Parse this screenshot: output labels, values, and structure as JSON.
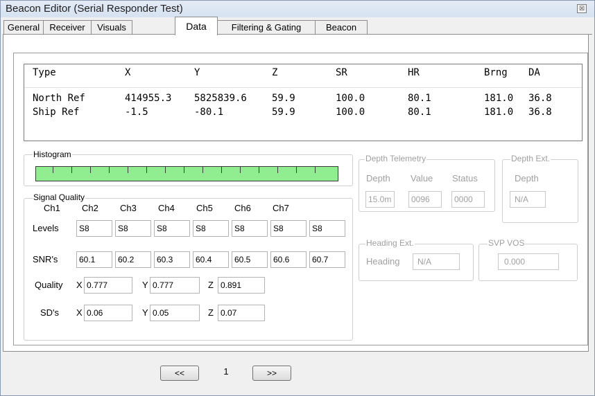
{
  "window": {
    "title": "Beacon Editor (Serial Responder Test)",
    "close_glyph": "☒"
  },
  "tabs": [
    "General",
    "Receiver",
    "Visuals",
    "Data",
    "Filtering & Gating",
    "Beacon"
  ],
  "active_tab": "Data",
  "grid": {
    "columns": [
      "Type",
      "X",
      "Y",
      "Z",
      "SR",
      "HR",
      "Brng",
      "DA"
    ],
    "rows": [
      [
        "North Ref",
        "414955.3",
        "5825839.6",
        "59.9",
        "100.0",
        "80.1",
        "181.0",
        "36.8"
      ],
      [
        "Ship Ref",
        "-1.5",
        "-80.1",
        "59.9",
        "100.0",
        "80.1",
        "181.0",
        "36.8"
      ]
    ]
  },
  "histogram": {
    "title": "Histogram",
    "bar_color": "#90ee90"
  },
  "signal_quality": {
    "title": "Signal Quality",
    "channels": [
      "Ch1",
      "Ch2",
      "Ch3",
      "Ch4",
      "Ch5",
      "Ch6",
      "Ch7"
    ],
    "levels_label": "Levels",
    "levels": [
      "S8",
      "S8",
      "S8",
      "S8",
      "S8",
      "S8",
      "S8"
    ],
    "snr_label": "SNR's",
    "snrs": [
      "60.1",
      "60.2",
      "60.3",
      "60.4",
      "60.5",
      "60.6",
      "60.7"
    ],
    "quality_label": "Quality",
    "quality": {
      "x_label": "X",
      "x": "0.777",
      "y_label": "Y",
      "y": "0.777",
      "z_label": "Z",
      "z": "0.891"
    },
    "sd_label": "SD's",
    "sd": {
      "x_label": "X",
      "x": "0.06",
      "y_label": "Y",
      "y": "0.05",
      "z_label": "Z",
      "z": "0.07"
    }
  },
  "depth_telemetry": {
    "title": "Depth Telemetry",
    "depth_label": "Depth",
    "value_label": "Value",
    "status_label": "Status",
    "depth": "15.0m",
    "value": "0096",
    "status": "0000"
  },
  "depth_ext": {
    "title": "Depth Ext.",
    "depth_label": "Depth",
    "depth": "N/A"
  },
  "heading_ext": {
    "title": "Heading Ext.",
    "heading_label": "Heading",
    "heading": "N/A"
  },
  "svp_vos": {
    "title": "SVP VOS",
    "value": "0.000"
  },
  "pager": {
    "prev_label": "<<",
    "page": "1",
    "next_label": ">>"
  }
}
